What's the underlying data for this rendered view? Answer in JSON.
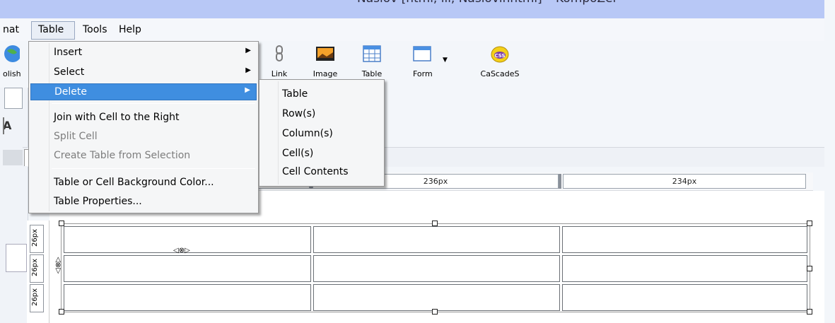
{
  "window": {
    "title": "Nasiov [html, ili, Nasiovinhtml] – KompoZer"
  },
  "menubar": {
    "items": [
      {
        "label": "nat"
      },
      {
        "label": "Table"
      },
      {
        "label": "Tools"
      },
      {
        "label": "Help"
      }
    ]
  },
  "toolbar": {
    "buttons": [
      {
        "label": "olish",
        "icon": "globe-publish-icon"
      },
      {
        "label": "Link",
        "icon": "chain-link-icon"
      },
      {
        "label": "Image",
        "icon": "picture-icon"
      },
      {
        "label": "Table",
        "icon": "table-icon"
      },
      {
        "label": "Form",
        "icon": "form-icon"
      },
      {
        "label": "CaScadeS",
        "icon": "css-icon"
      }
    ]
  },
  "format_bar": {
    "style_glyph": "A"
  },
  "table_menu": {
    "items": [
      {
        "label": "Insert",
        "has_submenu": true,
        "enabled": true
      },
      {
        "label": "Select",
        "has_submenu": true,
        "enabled": true
      },
      {
        "label": "Delete",
        "has_submenu": true,
        "enabled": true,
        "highlighted": true
      },
      {
        "label": "Join with Cell to the Right",
        "enabled": true
      },
      {
        "label": "Split Cell",
        "enabled": false
      },
      {
        "label": "Create Table from Selection",
        "enabled": false
      },
      {
        "label": "Table or Cell Background Color...",
        "enabled": true
      },
      {
        "label": "Table Properties...",
        "enabled": true
      }
    ]
  },
  "delete_submenu": {
    "items": [
      {
        "label": "Table"
      },
      {
        "label": "Row(s)"
      },
      {
        "label": "Column(s)"
      },
      {
        "label": "Cell(s)"
      },
      {
        "label": "Cell Contents"
      }
    ]
  },
  "ruler": {
    "columns": [
      "236px",
      "234px"
    ]
  },
  "row_ruler": {
    "rows": [
      "26px",
      "26px",
      "26px"
    ]
  },
  "colors": {
    "highlight": "#3f8ee0",
    "title_bar": "#b8c8f6",
    "menu_bg": "#f5f6f7"
  }
}
